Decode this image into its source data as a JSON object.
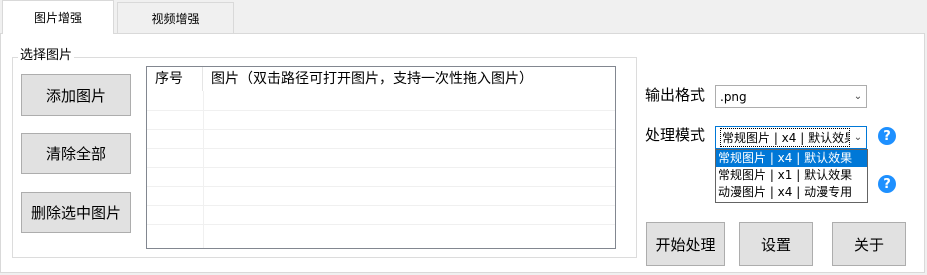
{
  "tabs": [
    {
      "label": "图片增强",
      "active": true
    },
    {
      "label": "视频增强",
      "active": false
    }
  ],
  "image_group": {
    "title": "选择图片",
    "buttons": {
      "add": "添加图片",
      "clear": "清除全部",
      "delete": "删除选中图片"
    },
    "list": {
      "columns": [
        "序号",
        "图片（双击路径可打开图片，支持一次性拖入图片）"
      ]
    }
  },
  "output": {
    "format_label": "输出格式",
    "format_value": ".png",
    "mode_label": "处理模式",
    "mode_value": "常规图片 | x4 | 默认效果",
    "mode_options": [
      "常规图片 | x4 | 默认效果",
      "常规图片 | x1 | 默认效果",
      "动漫图片 | x4 | 动漫专用"
    ]
  },
  "actions": {
    "start": "开始处理",
    "settings": "设置",
    "about": "关于"
  },
  "icons": {
    "help": "?"
  },
  "colors": {
    "accent": "#0078d7",
    "help_icon": "#1e90ff"
  }
}
